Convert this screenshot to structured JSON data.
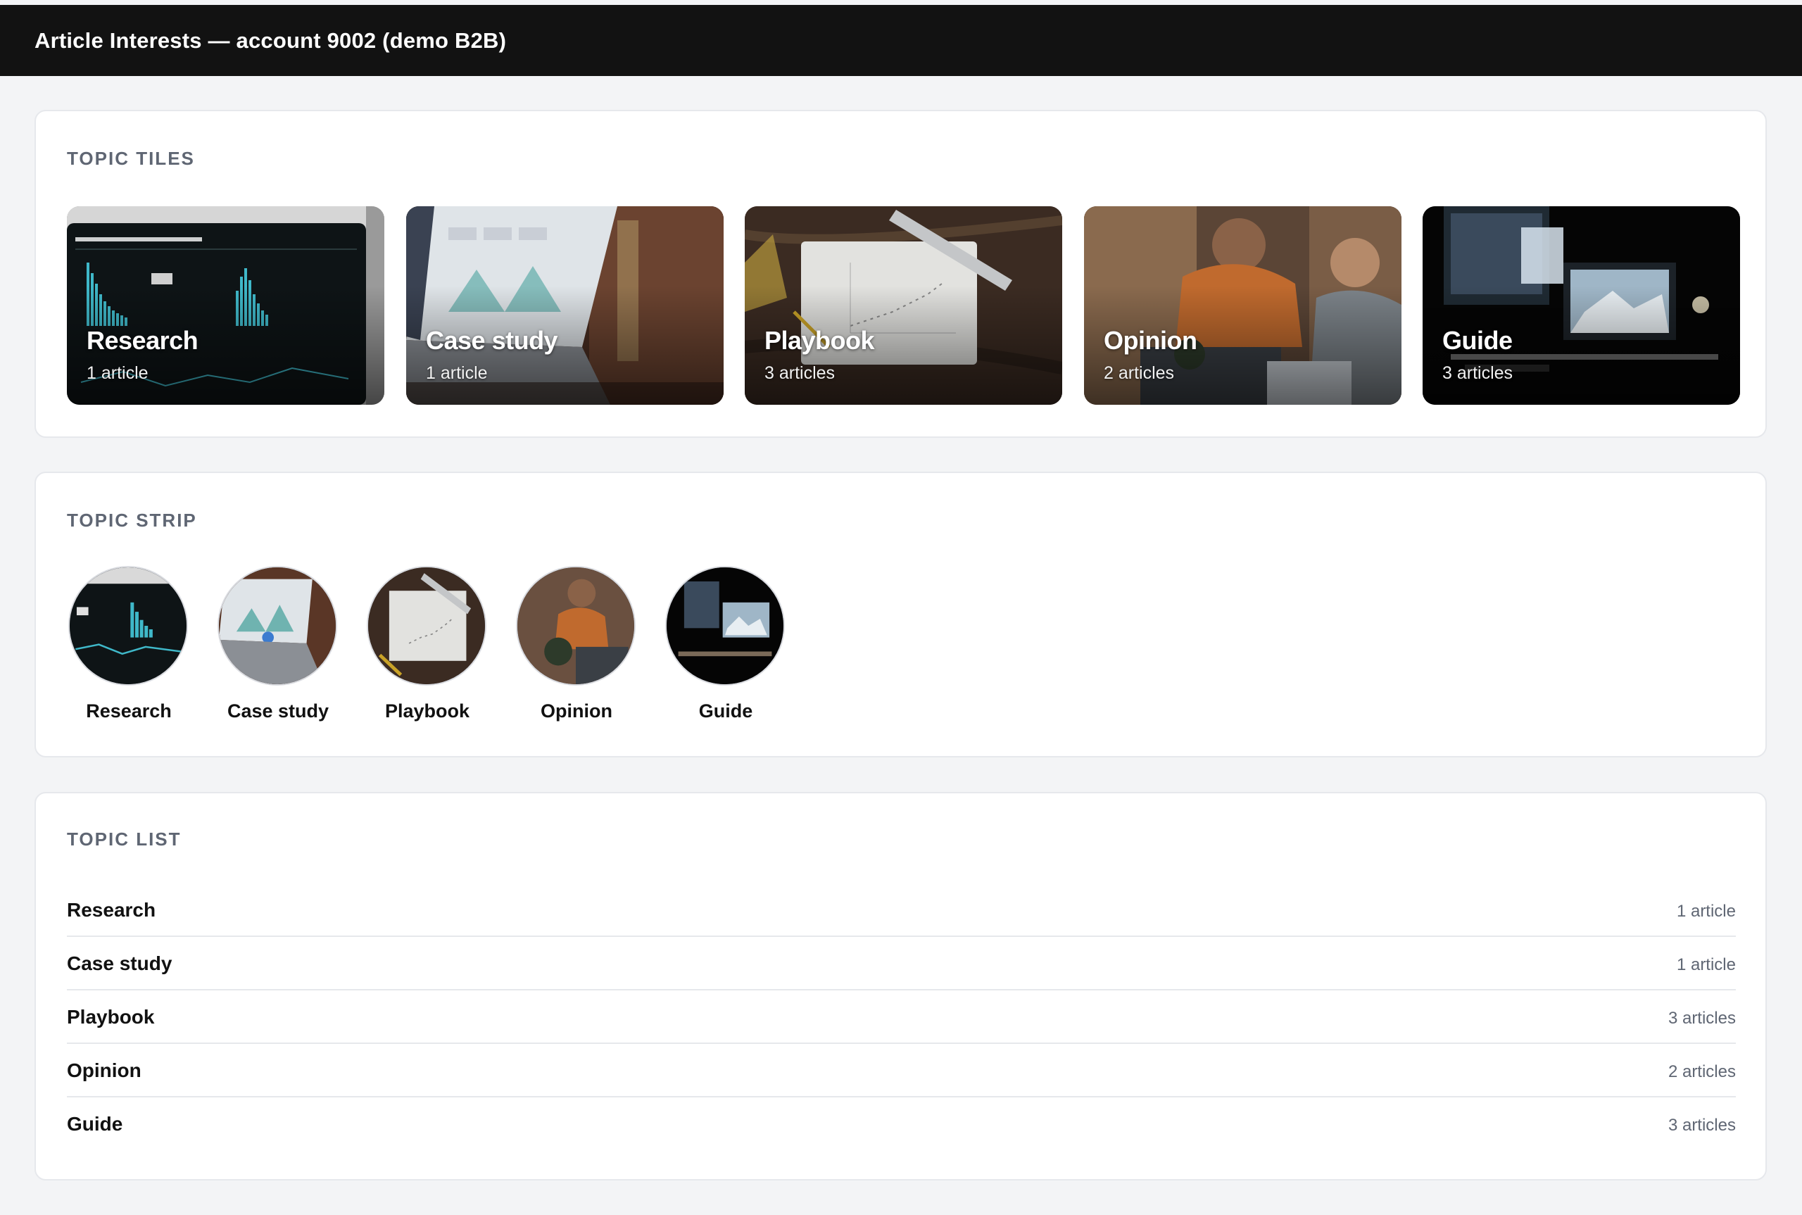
{
  "header": {
    "title": "Article Interests — account 9002 (demo B2B)"
  },
  "sections": {
    "tiles_title": "TOPIC TILES",
    "strip_title": "TOPIC STRIP",
    "list_title": "TOPIC LIST"
  },
  "topics": [
    {
      "name": "Research",
      "count": "1 article",
      "image": "analytics-dashboard-monitor"
    },
    {
      "name": "Case study",
      "count": "1 article",
      "image": "laptop-charts"
    },
    {
      "name": "Playbook",
      "count": "3 articles",
      "image": "paper-ruler-desk"
    },
    {
      "name": "Opinion",
      "count": "2 articles",
      "image": "people-working-laptops"
    },
    {
      "name": "Guide",
      "count": "3 articles",
      "image": "dark-desk-monitors"
    }
  ],
  "colors": {
    "topbar": "#121212",
    "background": "#f3f4f6",
    "card": "#ffffff",
    "section_title": "#5f6673",
    "divider": "#e6e8ec"
  }
}
